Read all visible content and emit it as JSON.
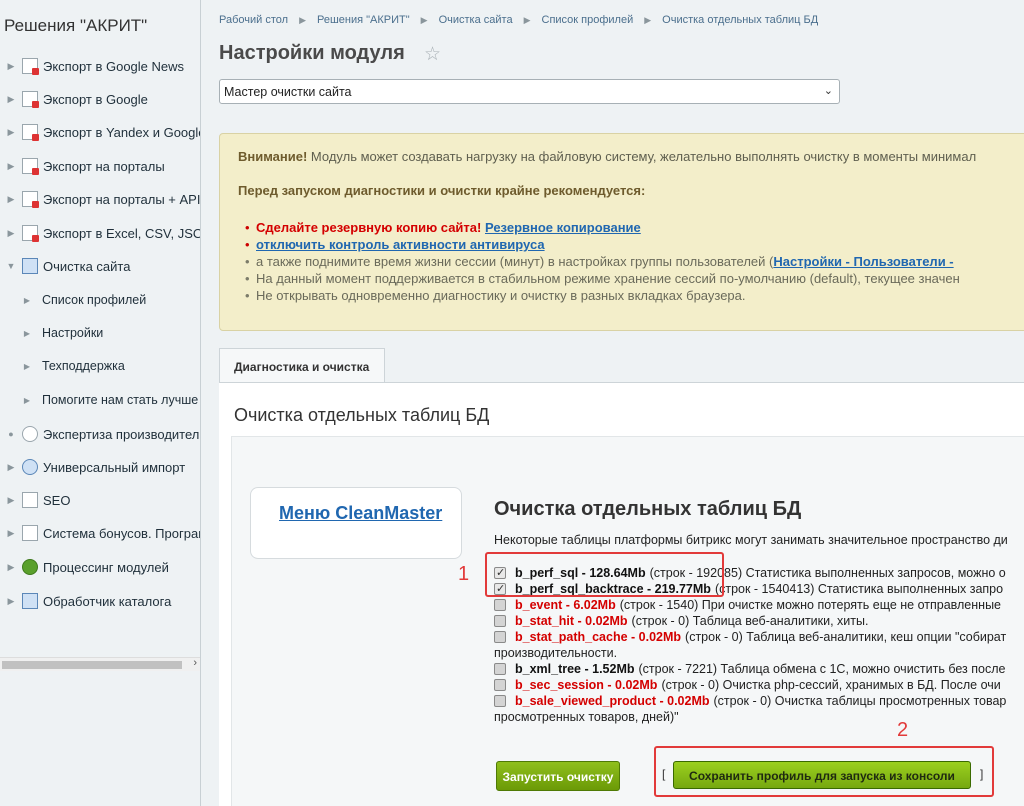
{
  "sidebar": {
    "title": "Решения \"АКРИТ\"",
    "items": [
      {
        "label": "Экспорт в Google News",
        "icon": "export-icon"
      },
      {
        "label": "Экспорт в Google",
        "icon": "export-icon"
      },
      {
        "label": "Экспорт в Yandex и Google",
        "icon": "export-icon"
      },
      {
        "label": "Экспорт на порталы",
        "icon": "export-icon"
      },
      {
        "label": "Экспорт на порталы + API",
        "icon": "export-icon"
      },
      {
        "label": "Экспорт в Excel, CSV, JSON",
        "icon": "export-icon"
      },
      {
        "label": "Очистка сайта",
        "icon": "tools-icon",
        "expanded": true
      },
      {
        "label": "Список профилей",
        "sub": true
      },
      {
        "label": "Настройки",
        "sub": true
      },
      {
        "label": "Техподдержка",
        "sub": true
      },
      {
        "label": "Помогите нам стать лучше",
        "sub": true
      },
      {
        "label": "Экспертиза производительн",
        "icon": "gauge-icon"
      },
      {
        "label": "Универсальный импорт",
        "icon": "import-icon"
      },
      {
        "label": "SEO",
        "icon": "chart-icon"
      },
      {
        "label": "Система бонусов. Программ",
        "icon": "bonus-icon"
      },
      {
        "label": "Процессинг модулей",
        "icon": "processing-icon"
      },
      {
        "label": "Обработчик каталога",
        "icon": "catalog-icon"
      }
    ]
  },
  "breadcrumb": [
    "Рабочий стол",
    "Решения \"АКРИТ\"",
    "Очистка сайта",
    "Список профилей",
    "Очистка отдельных таблиц БД"
  ],
  "page_title": "Настройки модуля",
  "select_value": "Мастер очистки сайта",
  "notice": {
    "warning_bold": "Внимание!",
    "warning_text": " Модуль может создавать нагрузку на файловую систему, желательно выполнять очистку в моменты минимал",
    "recommend": "Перед запуском диагностики и очистки крайне рекомендуется:",
    "backup_red": "Сделайте резервную копию сайта!",
    "backup_link": "Резервное копирование",
    "antivirus_link": "отключить контроль активности антивируса",
    "session_text": "а также поднимите время жизни сессии (минут) в настройках группы пользователей (",
    "session_link": "Настройки - Пользователи -",
    "stable_text": "На данный момент поддерживается в стабильном режиме хранение сессий по-умолчанию (default), текущее значен",
    "tabs_text": "Не открывать одновременно диагностику и очистку в разных вкладках браузера."
  },
  "tab_label": "Диагностика и очистка",
  "section_title": "Очистка отдельных таблиц БД",
  "cleanmaster_link": "Меню CleanMaster",
  "heading": "Очистка отдельных таблиц БД",
  "intro": "Некоторые таблицы платформы битрикс могут занимать значительное пространство ди",
  "tables": [
    {
      "name": "b_perf_sql - 128.64Mb",
      "desc": "(строк - 192085) Статистика выполненных запросов, можно о",
      "checked": true,
      "dark": true
    },
    {
      "name": "b_perf_sql_backtrace - 219.77Mb",
      "desc": "(строк - 1540413) Статистика выполненных запро",
      "checked": true,
      "dark": true
    },
    {
      "name": "b_event - 6.02Mb",
      "desc": "(строк - 1540) При очистке можно потерять еще не отправленные",
      "checked": false
    },
    {
      "name": "b_stat_hit - 0.02Mb",
      "desc": "(строк - 0) Таблица веб-аналитики, хиты.",
      "checked": false
    },
    {
      "name": "b_stat_path_cache - 0.02Mb",
      "desc": "(строк - 0) Таблица веб-аналитики, кеш опции \"собират",
      "checked": false,
      "cont": "производительности."
    },
    {
      "name": "b_xml_tree - 1.52Mb",
      "desc": "(строк - 7221) Таблица обмена с 1С, можно очистить без после",
      "checked": false,
      "dark": true
    },
    {
      "name": "b_sec_session - 0.02Mb",
      "desc": "(строк - 0) Очистка php-сессий, хранимых в БД. После очи",
      "checked": false
    },
    {
      "name": "b_sale_viewed_product - 0.02Mb",
      "desc": "(строк - 0) Очистка таблицы просмотренных товар",
      "checked": false,
      "cont": "просмотренных товаров, дней)\""
    }
  ],
  "run_button": "Запустить очистку",
  "save_button": "Сохранить профиль для запуска из консоли",
  "bracket_open": "[",
  "bracket_close": "]",
  "markers": [
    "1",
    "2"
  ],
  "colors": {
    "accent_red": "#d40000",
    "link": "#2067b0",
    "button_green": "#7aab10",
    "annotation": "#e23a3a"
  }
}
